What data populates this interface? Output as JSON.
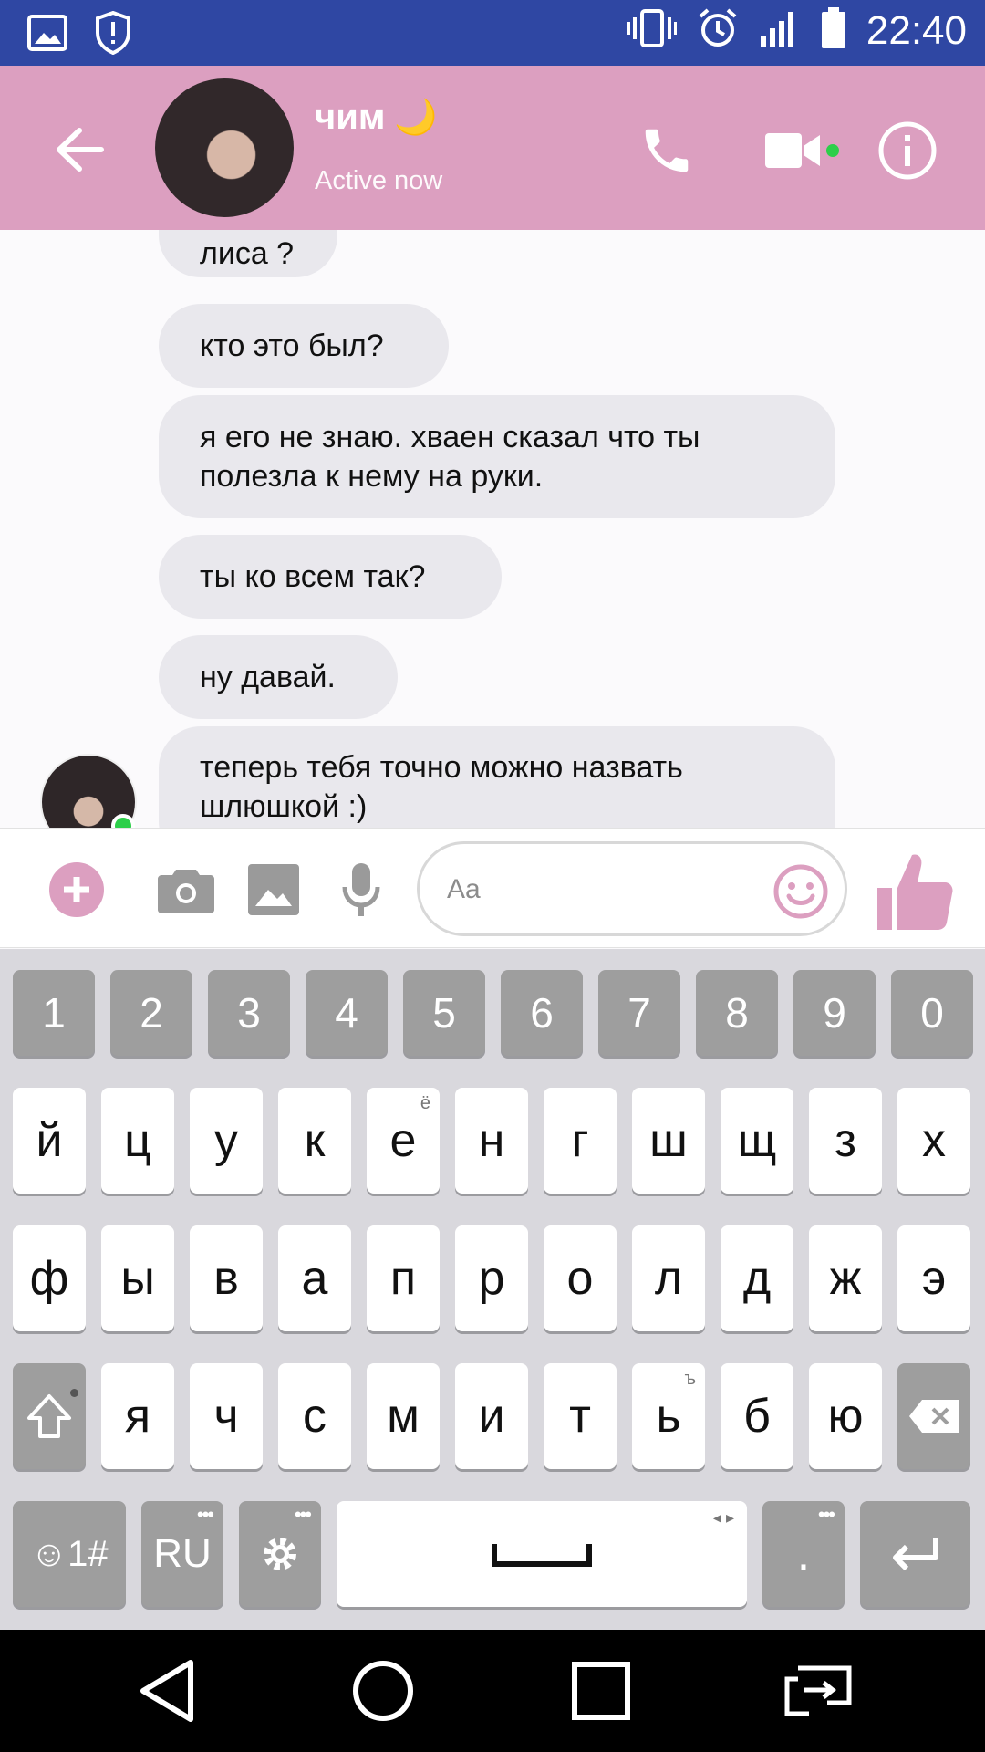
{
  "status_bar": {
    "time": "22:40",
    "icons": [
      "gallery-icon",
      "shield-icon",
      "vibrate-icon",
      "alarm-icon",
      "signal-icon",
      "battery-icon"
    ]
  },
  "header": {
    "name": "чим",
    "name_emoji": "🌙",
    "status": "Active now",
    "accent_color": "#dc9fc0"
  },
  "messages": [
    {
      "text": "лиса ?"
    },
    {
      "text": "кто это был?"
    },
    {
      "text": "я его не знаю. хваен сказал что ты полезла к нему на руки."
    },
    {
      "text": "ты ко всем так?"
    },
    {
      "text": "ну давай."
    },
    {
      "text": "теперь тебя точно можно назвать шлюшкой :)"
    }
  ],
  "composer": {
    "placeholder": "Aa",
    "value": ""
  },
  "keyboard": {
    "numbers": [
      "1",
      "2",
      "3",
      "4",
      "5",
      "6",
      "7",
      "8",
      "9",
      "0"
    ],
    "row1": [
      "й",
      "ц",
      "у",
      "к",
      "е",
      "н",
      "г",
      "ш",
      "щ",
      "з",
      "х"
    ],
    "row1_alt_e": "ё",
    "row2": [
      "ф",
      "ы",
      "в",
      "а",
      "п",
      "р",
      "о",
      "л",
      "д",
      "ж",
      "э"
    ],
    "row3": [
      "я",
      "ч",
      "с",
      "м",
      "и",
      "т",
      "ь",
      "б",
      "ю"
    ],
    "row3_alt_soft": "ъ",
    "symbols_label": "☺1#",
    "lang_label": "RU",
    "period_label": ".",
    "space_arrows": "◂ ▸"
  }
}
